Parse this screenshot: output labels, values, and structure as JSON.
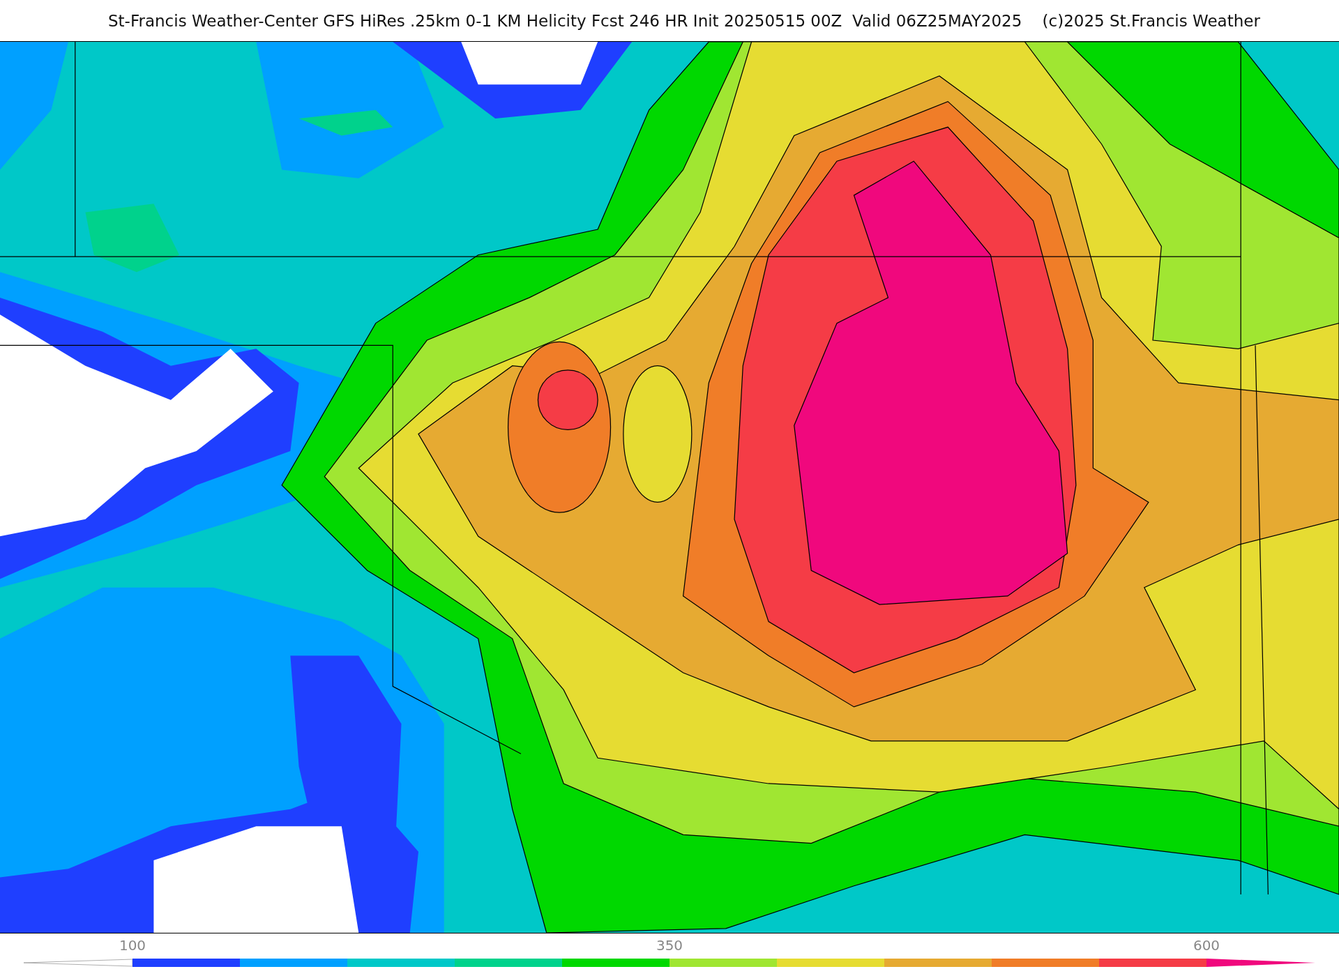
{
  "title": "St-Francis Weather-Center GFS HiRes .25km 0-1 KM Helicity Fcst 246 HR Init 20250515 00Z  Valid 06Z25MAY2025    (c)2025 St.Francis Weather",
  "colorbar": {
    "under": {
      "color": "#ffffff"
    },
    "bins": [
      {
        "color": "#1f3fff",
        "label": "100"
      },
      {
        "color": "#00a0ff"
      },
      {
        "color": "#00c8c8"
      },
      {
        "color": "#00d28c"
      },
      {
        "color": "#00d800"
      },
      {
        "color": "#a0e632",
        "label": "350"
      },
      {
        "color": "#e6dc32"
      },
      {
        "color": "#e6aa32"
      },
      {
        "color": "#f07d28"
      },
      {
        "color": "#f53c46"
      }
    ],
    "over": {
      "color": "#f0087d",
      "label": "600"
    }
  }
}
